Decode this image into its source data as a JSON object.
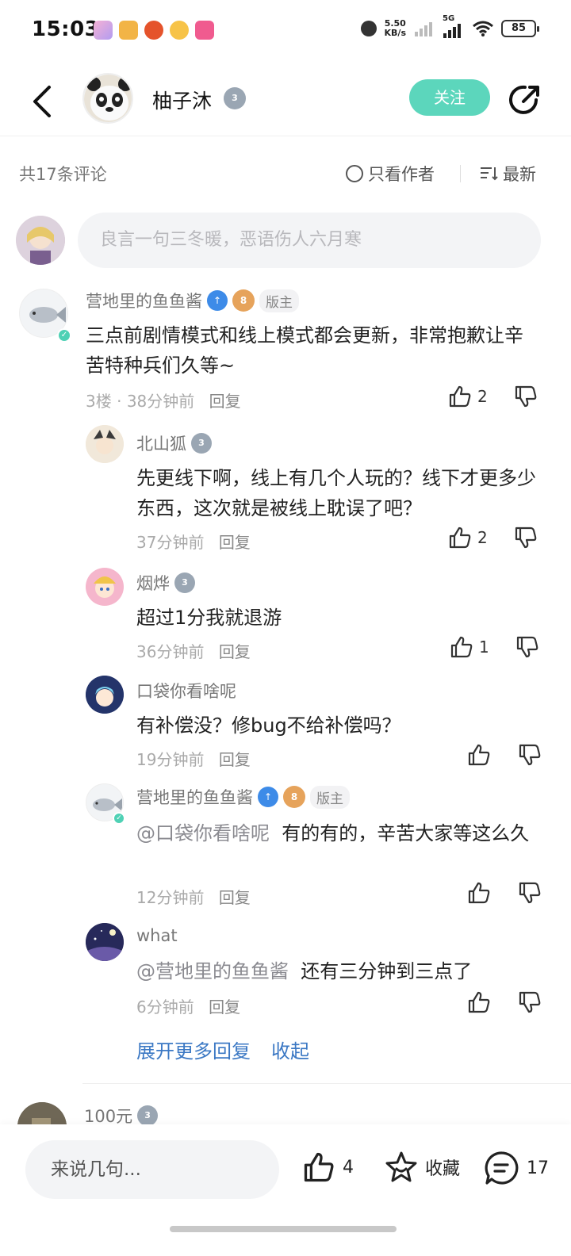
{
  "status_bar": {
    "time": "15:03",
    "net_speed_top": "5.50",
    "net_speed_bottom": "KB/s",
    "signal_label": "5G",
    "battery": "85"
  },
  "header": {
    "author_name": "柚子沐",
    "author_level": "3",
    "follow_label": "关注"
  },
  "comments_bar": {
    "count_label": "共17条评论",
    "only_author_label": "只看作者",
    "sort_label": "最新"
  },
  "input_placeholder": "良言一句三冬暖，恶语伤人六月寒",
  "main_comment": {
    "user": "营地里的鱼鱼酱",
    "level": "8",
    "tag": "版主",
    "text": "三点前剧情模式和线上模式都会更新，非常抱歉让辛苦特种兵们久等~",
    "floor": "3楼",
    "time": "38分钟前",
    "reply": "回复",
    "likes": "2"
  },
  "replies": [
    {
      "user": "北山狐",
      "level": "3",
      "text": "先更线下啊，线上有几个人玩的？线下才更多少东西，这次就是被线上耽误了吧？",
      "time": "37分钟前",
      "reply": "回复",
      "likes": "2"
    },
    {
      "user": "烟烨",
      "level": "3",
      "text": "超过1分我就退游",
      "time": "36分钟前",
      "reply": "回复",
      "likes": "1"
    },
    {
      "user": "口袋你看啥呢",
      "text": "有补偿没？修bug不给补偿吗？",
      "time": "19分钟前",
      "reply": "回复",
      "likes": ""
    },
    {
      "user": "营地里的鱼鱼酱",
      "level": "8",
      "tag": "版主",
      "mention": "@口袋你看啥呢",
      "text": "有的有的，辛苦大家等这么久",
      "time": "12分钟前",
      "reply": "回复",
      "likes": ""
    },
    {
      "user": "what",
      "mention": "@营地里的鱼鱼酱",
      "text": "还有三分钟到三点了",
      "time": "6分钟前",
      "reply": "回复",
      "likes": ""
    }
  ],
  "expand_more": "展开更多回复",
  "collapse": "收起",
  "next_comment": {
    "user": "100元",
    "level": "3"
  },
  "bottom_bar": {
    "input_placeholder": "来说几句...",
    "like_count": "4",
    "favorite_label": "收藏",
    "comment_count": "17"
  },
  "colors": {
    "accent": "#5cd6bc",
    "link": "#3b78c4"
  }
}
